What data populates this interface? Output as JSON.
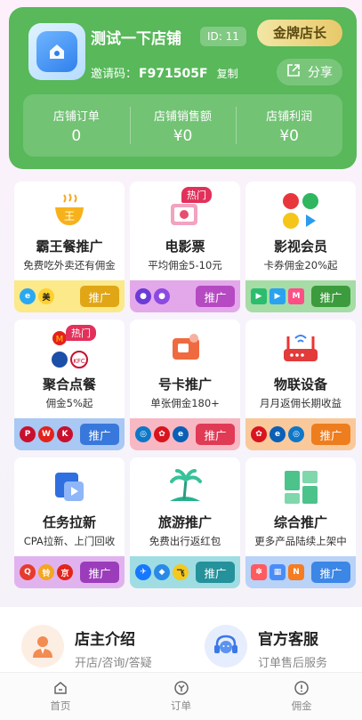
{
  "header": {
    "shop_name": "测试一下店铺",
    "shop_id": "ID: 11",
    "level": "金牌店长",
    "invite_label": "邀请码：",
    "invite_code": "F971505F",
    "copy_label": "复制",
    "share_label": "分享",
    "stats": [
      {
        "label": "店铺订单",
        "value": "0"
      },
      {
        "label": "店铺销售额",
        "value": "¥0"
      },
      {
        "label": "店铺利润",
        "value": "¥0"
      }
    ]
  },
  "tiles": [
    {
      "title": "霸王餐推广",
      "subtitle": "免费吃外卖还有佣金",
      "button": "推广",
      "hot": "",
      "bar_color": "#fbe98a",
      "button_color": "#e0a615",
      "icon": "bawangcan-icon"
    },
    {
      "title": "电影票",
      "subtitle": "平均佣金5-10元",
      "button": "推广",
      "hot": "热门",
      "bar_color": "#e3a8ea",
      "button_color": "#b64ac2",
      "icon": "movie-ticket-icon"
    },
    {
      "title": "影视会员",
      "subtitle": "卡券佣金20%起",
      "button": "推广",
      "hot": "",
      "bar_color": "#a6dca6",
      "button_color": "#3c9b3c",
      "icon": "video-member-icon"
    },
    {
      "title": "聚合点餐",
      "subtitle": "佣金5%起",
      "button": "推广",
      "hot": "热门",
      "bar_color": "#a9c8f3",
      "button_color": "#3878dc",
      "icon": "food-order-icon"
    },
    {
      "title": "号卡推广",
      "subtitle": "单张佣金180+",
      "button": "推广",
      "hot": "",
      "bar_color": "#f7b8c3",
      "button_color": "#e03a55",
      "icon": "sim-card-icon"
    },
    {
      "title": "物联设备",
      "subtitle": "月月返佣长期收益",
      "button": "推广",
      "hot": "",
      "bar_color": "#f9c99c",
      "button_color": "#ee7d1e",
      "icon": "router-icon"
    },
    {
      "title": "任务拉新",
      "subtitle": "CPA拉新、上门回收",
      "button": "推广",
      "hot": "",
      "bar_color": "#e1b3ee",
      "button_color": "#9b3dbb",
      "icon": "task-icon"
    },
    {
      "title": "旅游推广",
      "subtitle": "免费出行返红包",
      "button": "推广",
      "hot": "",
      "bar_color": "#9fdde3",
      "button_color": "#24919b",
      "icon": "travel-icon"
    },
    {
      "title": "综合推广",
      "subtitle": "更多产品陆续上架中",
      "button": "推广",
      "hot": "",
      "bar_color": "#b9d2f7",
      "button_color": "#3c86e6",
      "icon": "grid-icon"
    }
  ],
  "services": [
    {
      "title": "店主介绍",
      "subtitle": "开店/咨询/答疑",
      "icon": "shop-owner-icon"
    },
    {
      "title": "官方客服",
      "subtitle": "订单售后服务",
      "icon": "customer-service-icon"
    }
  ],
  "tabbar": [
    {
      "label": "首页",
      "icon": "home-icon"
    },
    {
      "label": "订单",
      "icon": "order-icon"
    },
    {
      "label": "佣金",
      "icon": "commission-icon"
    }
  ]
}
